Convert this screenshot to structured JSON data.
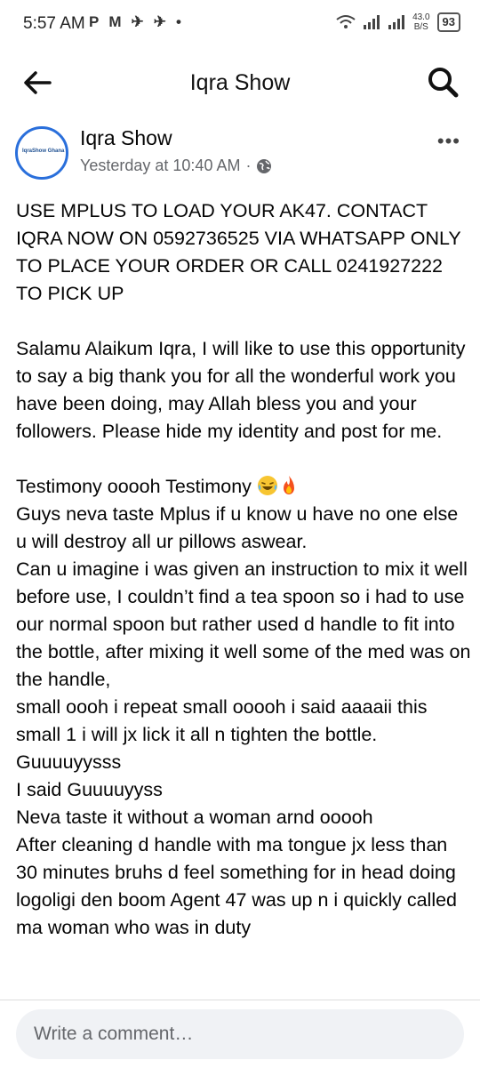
{
  "status_bar": {
    "time": "5:57 AM",
    "icons": [
      "P",
      "M",
      "✈",
      "✈",
      "•"
    ],
    "net_speed": "43.0",
    "net_unit": "B/S",
    "battery": "93"
  },
  "header": {
    "title": "Iqra Show"
  },
  "post": {
    "author": "Iqra Show",
    "avatar_text": "IqraShow Ghana",
    "timestamp": "Yesterday at 10:40 AM",
    "separator": "·",
    "headline": "USE MPLUS TO LOAD YOUR AK47. CONTACT IQRA NOW ON 0592736525 VIA WHATSAPP ONLY TO PLACE YOUR ORDER OR CALL 0241927222 TO PICK UP",
    "para1": "Salamu Alaikum Iqra, I will like to use this opportunity to say a big thank you for all the wonderful work you have been doing, may Allah bless you and your followers. Please hide my identity and post for me.",
    "testimony": "Testimony ooooh Testimony",
    "lines": [
      "Guys neva taste Mplus if u know u have no one else u will destroy all ur pillows aswear.",
      "Can u imagine i was given an instruction to mix it well before use, I couldn’t find a tea spoon so i had to use our normal spoon but rather used d handle to fit into the bottle, after mixing it well some of the med was on the handle,",
      "small oooh i repeat small ooooh i said aaaaii this small 1 i will jx lick it all n tighten the bottle.",
      "Guuuuyysss",
      "I said Guuuuyyss",
      "Neva taste it without a woman arnd ooooh",
      "After cleaning d handle with ma tongue jx less than 30 minutes bruhs d feel something for in head doing logoligi den boom Agent 47 was up n i quickly called ma woman who was in duty"
    ]
  },
  "comment": {
    "placeholder": "Write a comment…"
  },
  "colors": {
    "accent": "#2a6fdb",
    "meta_gray": "#65676b",
    "input_bg": "#f0f2f5"
  }
}
